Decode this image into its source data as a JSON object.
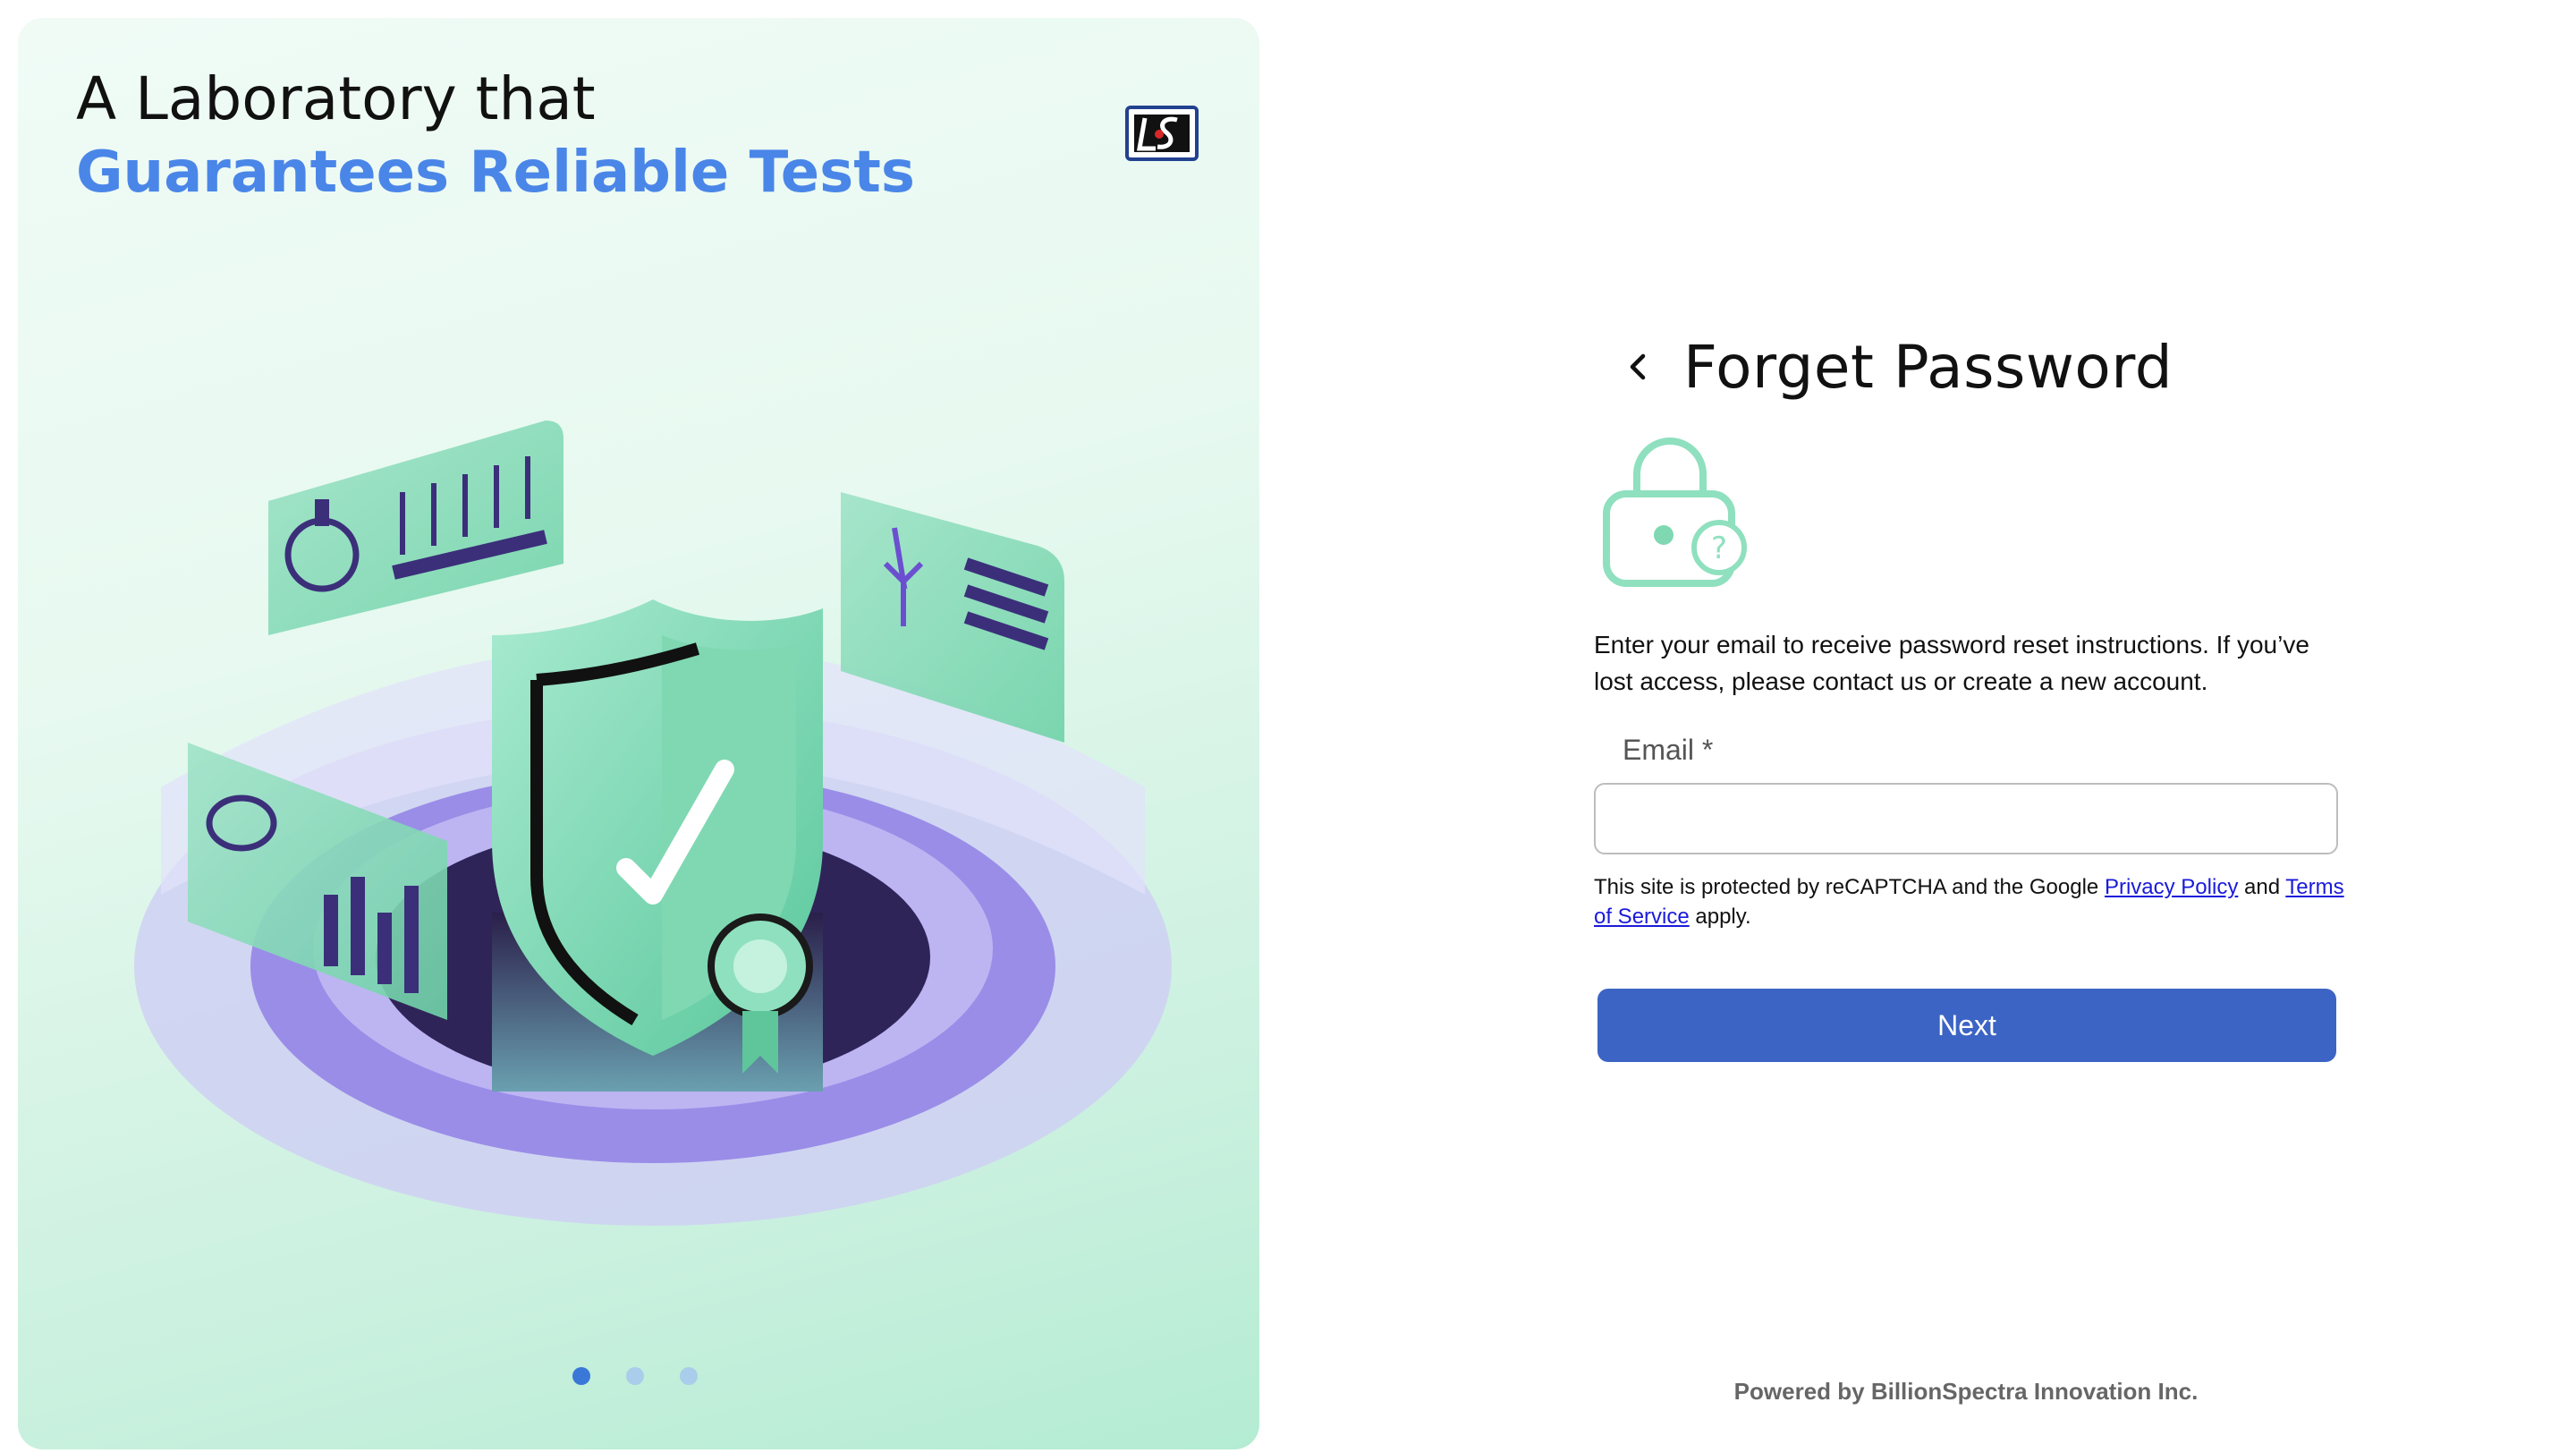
{
  "hero": {
    "title_line1": "A Laboratory that",
    "title_line2": "Guarantees Reliable Tests",
    "accent_color": "#4a86e8",
    "carousel": {
      "slide_count": 3,
      "active_index": 0
    }
  },
  "form": {
    "title": "Forget Password",
    "description": "Enter your email to receive password reset instructions. If you’ve lost access, please contact us or create a new account.",
    "email_label": "Email *",
    "email_value": "",
    "captcha_prefix": "This site is protected by reCAPTCHA and the Google",
    "privacy_link": "Privacy Policy",
    "captcha_and": "and",
    "terms_link": "Terms of Service",
    "captcha_suffix": "apply.",
    "next_label": "Next",
    "button_color": "#3c64c4"
  },
  "footer": {
    "text": "Powered by BillionSpectra Innovation Inc."
  },
  "icons": {
    "back": "chevron-left-icon",
    "lock": "lock-question-icon",
    "logo": "brand-logo",
    "hero": "security-shield-illustration"
  }
}
